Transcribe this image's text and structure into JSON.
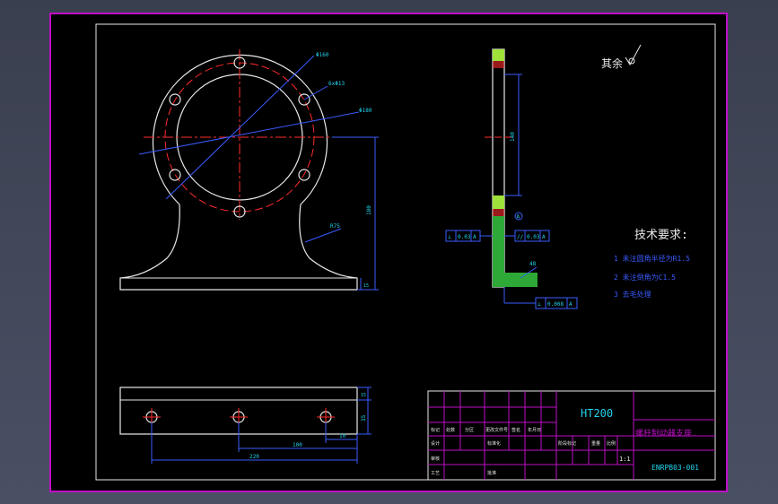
{
  "drawing": {
    "material": "HT200",
    "part_name": "螺杆制动器支座",
    "drawing_number": "ENRPB03-001",
    "roughness_note": "其余",
    "tech_title": "技术要求:",
    "tech_notes": [
      "1 未注圆角半径为R1.5",
      "2 未注倒角为C1.5",
      "3 去毛处理"
    ],
    "scale": "1:1",
    "title_block_labels": [
      "标记",
      "处数",
      "分区",
      "更改文件号",
      "签名",
      "年月日",
      "设计",
      "标准化",
      "阶段标记",
      "重量",
      "比例",
      "审核",
      "工艺",
      "批准"
    ],
    "front_view_dims": {
      "bolt_circle": "Φ160",
      "holes": "6xΦ13",
      "outer": "Φ180",
      "fillet": "R75",
      "height": "180",
      "base": "15"
    },
    "side_view_dims": {
      "tolerance_left": [
        "⊥",
        "0.03",
        "A"
      ],
      "tolerance_right": [
        "//",
        "0.03",
        "A"
      ],
      "bottom_tolerance": [
        "⊥",
        "0.008",
        "A"
      ],
      "datum": "A",
      "flange_dim": "48",
      "length": "140"
    },
    "bottom_view_dims": {
      "total_length": "220",
      "hole_spacing": "100",
      "end_offset": "10",
      "thickness": "15",
      "width": "35"
    }
  }
}
